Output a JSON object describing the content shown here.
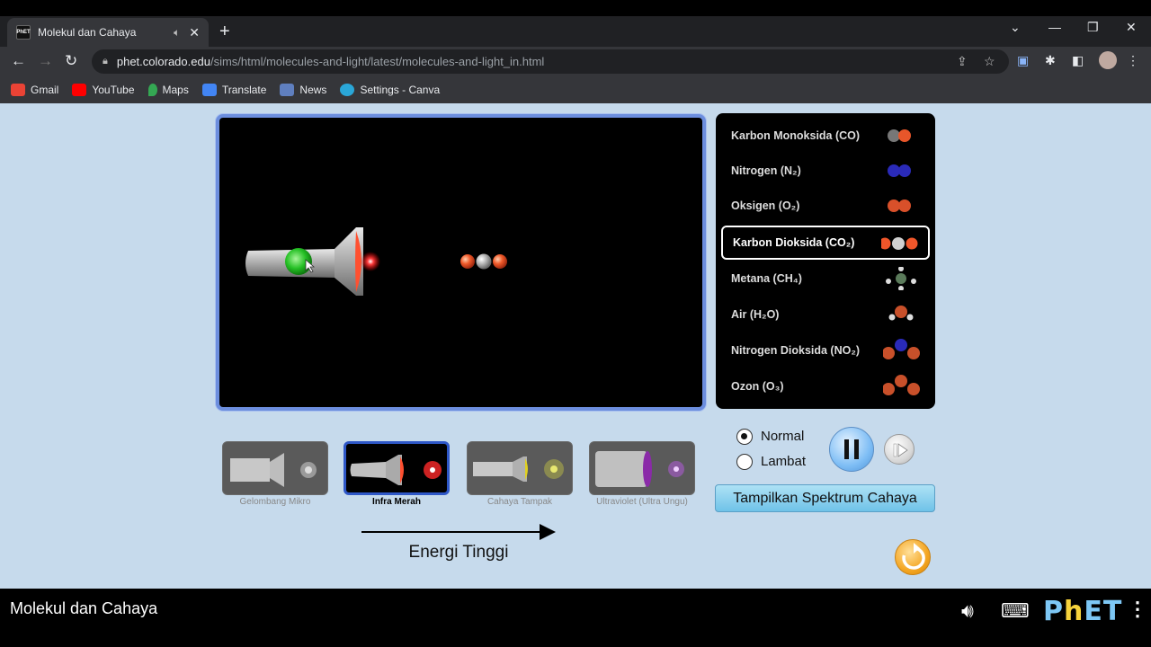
{
  "browser": {
    "tab_title": "Molekul dan Cahaya",
    "favicon_text": "PhET",
    "url_domain": "phet.colorado.edu",
    "url_path": "/sims/html/molecules-and-light/latest/molecules-and-light_in.html",
    "bookmarks": [
      {
        "label": "Gmail",
        "color": "#ea4335"
      },
      {
        "label": "YouTube",
        "color": "#ff0000"
      },
      {
        "label": "Maps",
        "color": "#34a853"
      },
      {
        "label": "Translate",
        "color": "#4285f4"
      },
      {
        "label": "News",
        "color": "#5f7fbf"
      },
      {
        "label": "Settings - Canva",
        "color": "#2aa7d8"
      }
    ]
  },
  "molecules": [
    {
      "label": "Karbon Monoksida (CO)",
      "icon": "co-molecule-icon"
    },
    {
      "label": "Nitrogen (N₂)",
      "icon": "n2-molecule-icon"
    },
    {
      "label": "Oksigen (O₂)",
      "icon": "o2-molecule-icon"
    },
    {
      "label": "Karbon Dioksida (CO₂)",
      "icon": "co2-molecule-icon",
      "selected": true
    },
    {
      "label": "Metana (CH₄)",
      "icon": "ch4-molecule-icon"
    },
    {
      "label": "Air (H₂O)",
      "icon": "h2o-molecule-icon"
    },
    {
      "label": "Nitrogen Dioksida (NO₂)",
      "icon": "no2-molecule-icon"
    },
    {
      "label": "Ozon (O₃)",
      "icon": "o3-molecule-icon"
    }
  ],
  "light_sources": [
    {
      "label": "Gelombang Mikro",
      "active": false
    },
    {
      "label": "Infra Merah",
      "active": true
    },
    {
      "label": "Cahaya Tampak",
      "active": false
    },
    {
      "label": "Ultraviolet (Ultra Ungu)",
      "active": false
    }
  ],
  "energy_label": "Energi Tinggi",
  "speed": {
    "normal_label": "Normal",
    "slow_label": "Lambat",
    "selected": "Normal"
  },
  "spectrum_button": "Tampilkan Spektrum Cahaya",
  "sim_title": "Molekul dan Cahaya",
  "phet_logo": {
    "p": "P",
    "h": "h",
    "et": "ET"
  },
  "colors": {
    "play_area_border": "#6c8ede",
    "sim_background": "#c6daec",
    "active_source_border": "#2e57c7",
    "spectrum_button": "#6fc2e8",
    "reset_button": "#f4a623"
  }
}
